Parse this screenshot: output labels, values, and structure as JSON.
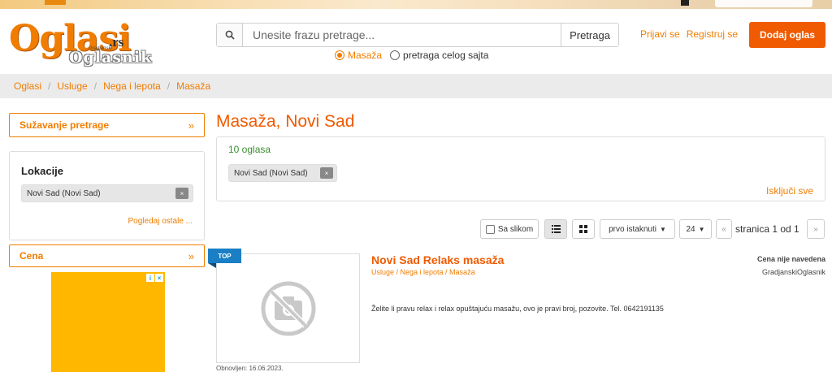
{
  "brand": {
    "logo_main": "Oglasi",
    "logo_tld": ".rs",
    "logo_small": "Gradjanski",
    "logo_sub": "Oglasnik"
  },
  "search": {
    "placeholder": "Unesite frazu pretrage...",
    "button": "Pretraga",
    "scope_options": [
      {
        "label": "Masaža",
        "selected": true
      },
      {
        "label": "pretraga celog sajta",
        "selected": false
      }
    ]
  },
  "auth": {
    "login": "Prijavi se",
    "register": "Registruj se",
    "add_ad": "Dodaj oglas"
  },
  "breadcrumb": [
    "Oglasi",
    "Usluge",
    "Nega i lepota",
    "Masaža"
  ],
  "sidebar": {
    "narrow_label": "Sužavanje pretrage",
    "narrow_chev": "»",
    "location_title": "Lokacije",
    "location_chip": "Novi Sad (Novi Sad)",
    "chip_close": "×",
    "location_more": "Pogledaj ostale ...",
    "price_label": "Cena",
    "price_chev": "»"
  },
  "main": {
    "title": "Masaža, Novi Sad",
    "count": "10 oglasa",
    "active_filter": "Novi Sad (Novi Sad)",
    "filter_close": "×",
    "exclude_all": "Isključi sve"
  },
  "toolbar": {
    "with_image": "Sa slikom",
    "sort": "prvo istaknuti",
    "per_page": "24",
    "prev": "«",
    "next": "»",
    "page_info": "stranica 1 od 1"
  },
  "listing": {
    "badge": "TOP",
    "title": "Novi Sad Relaks masaža",
    "category": "Usluge / Nega i lepota / Masaža",
    "description": "Želite li pravu relax i relax opuštajuću masažu, ovo je pravi broj, pozovite. Tel. 0642191135",
    "price": "Cena nije navedena",
    "seller": "GradjanskiOglasnik",
    "updated": "Obnovljen: 16.06.2023."
  },
  "colors": {
    "accent": "#f07d00",
    "button": "#f05a00",
    "count_green": "#3a8d2f",
    "badge_blue": "#1a7fc4",
    "ad_yellow": "#ffb700"
  }
}
